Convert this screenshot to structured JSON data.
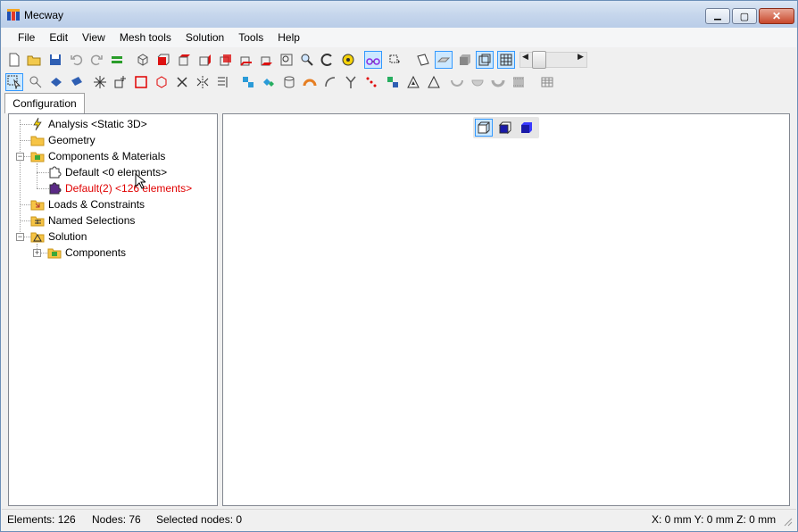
{
  "window": {
    "title": "Mecway",
    "min_glyph": "▁",
    "max_glyph": "▢",
    "close_glyph": "✕"
  },
  "menubar": {
    "items": [
      "File",
      "Edit",
      "View",
      "Mesh tools",
      "Solution",
      "Tools",
      "Help"
    ]
  },
  "toolbar1": {
    "icons": [
      "new-file-icon",
      "open-folder-icon",
      "save-icon",
      "undo-icon",
      "redo-icon",
      "equals-icon",
      "wireframe-cube-icon",
      "red-cube-front-icon",
      "red-cube-top-icon",
      "red-cube-right-icon",
      "red-cube-left-icon",
      "red-cube-back-icon",
      "red-cube-bottom-icon",
      "zoom-box-icon",
      "zoom-icon",
      "rotate-icon",
      "rotate-axis-icon",
      "glasses-icon",
      "select-dropdown-icon",
      "paper-icon",
      "flat-shade-icon",
      "solid-shade-icon",
      "wire-box-icon",
      "mesh-box-icon"
    ]
  },
  "toolbar2": {
    "icons": [
      "select-arrow-icon",
      "select-node-icon",
      "select-element-icon",
      "select-face-icon",
      "asterisk-icon",
      "node-add-icon",
      "square-icon",
      "hex-icon",
      "cross-icon",
      "mirror-icon",
      "align-icon",
      "move-nodes-icon",
      "copy-nodes-icon",
      "cylinder-icon",
      "bend-icon",
      "arc-icon",
      "fork-icon",
      "dots-icon",
      "contour-icon",
      "triangle-fill-icon",
      "triangle-icon",
      "bowl-icon",
      "bowl2-icon",
      "bowl3-icon",
      "film-icon",
      "table-icon"
    ]
  },
  "tabs": {
    "configuration": "Configuration"
  },
  "tree": {
    "analysis": "Analysis <Static 3D>",
    "geometry": "Geometry",
    "components_materials": "Components & Materials",
    "default_comp": "Default <0 elements>",
    "default2_comp": "Default(2) <126 elements>",
    "loads_constraints": "Loads & Constraints",
    "named_selections": "Named Selections",
    "solution": "Solution",
    "components": "Components",
    "expander_minus": "−",
    "expander_plus": "+"
  },
  "status": {
    "elements": "Elements: 126",
    "nodes": "Nodes: 76",
    "selected_nodes": "Selected nodes: 0",
    "coords": "X: 0 mm Y: 0 mm Z: 0 mm"
  },
  "colors": {
    "tree_highlight_red": "#e00000",
    "active_blue": "#3399ff"
  }
}
